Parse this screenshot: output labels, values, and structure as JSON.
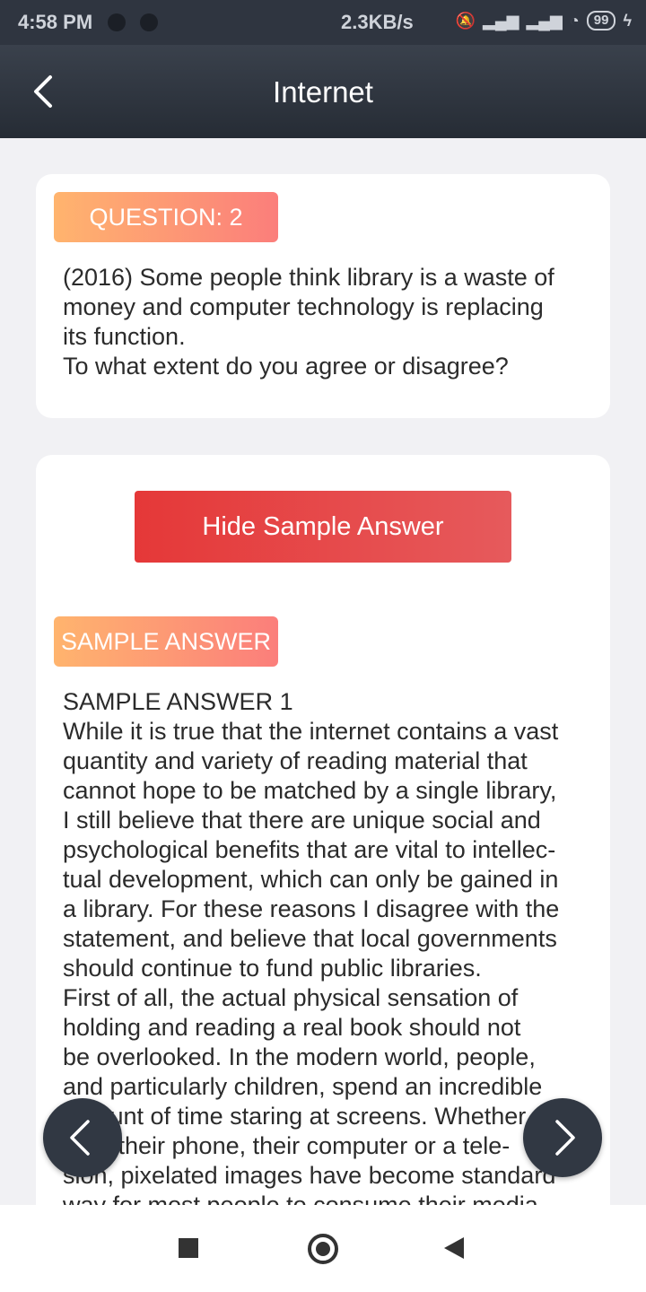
{
  "status_bar": {
    "time": "4:58 PM",
    "speed": "2.3KB/s",
    "battery": "99"
  },
  "header": {
    "title": "Internet",
    "back_icon": "chevron-left-icon"
  },
  "question_card": {
    "badge": "QUESTION: 2",
    "text_lines": [
      "(2016) Some people think library is a waste of",
      "money and computer technology is replacing",
      "its function.",
      "To what extent do you agree or disagree?"
    ]
  },
  "answer_card": {
    "hide_button_label": "Hide Sample Answer",
    "badge": "SAMPLE ANSWER",
    "lines": [
      "SAMPLE ANSWER 1",
      "While it is true that the internet contains a vast",
      "quantity and variety of reading material that",
      "cannot hope to be matched by a single library,",
      "I still believe that there are unique social and",
      "psychological benefits that are vital to intellec-",
      "tual development, which can only be gained in",
      "a library. For these reasons I disagree with the",
      "statement, and believe that local governments",
      "should continue to fund public libraries.",
      "First of all, the actual physical sensation of",
      "holding and reading a real book should not",
      "be overlooked. In the modern world, people,",
      "and particularly children, spend an incredible",
      "amount of time staring at screens. Whether",
      "from their phone, their computer or a tele-",
      "sion, pixelated images have become standard",
      "way for most people to consume their media"
    ]
  },
  "float_buttons": {
    "prev_icon": "chevron-left-icon",
    "next_icon": "chevron-right-icon"
  },
  "nav_bar": {
    "recents_icon": "square-icon",
    "home_icon": "circle-icon",
    "back_icon": "triangle-back-icon"
  }
}
